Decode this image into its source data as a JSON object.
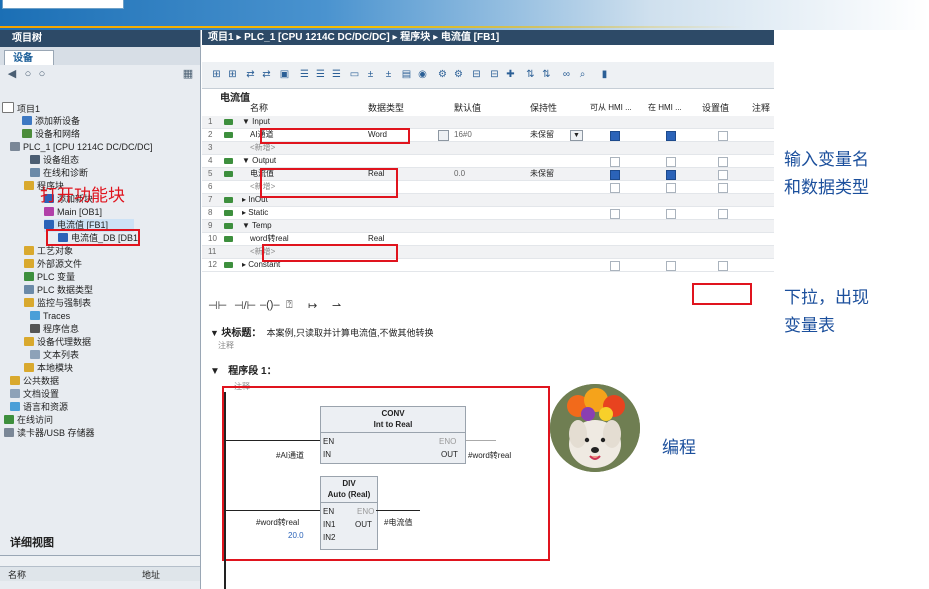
{
  "tree": {
    "title": "项目树",
    "tab": "设备",
    "items": [
      {
        "label": "项目1"
      },
      {
        "label": "添加新设备"
      },
      {
        "label": "设备和网络"
      },
      {
        "label": "PLC_1 [CPU 1214C DC/DC/DC]"
      },
      {
        "label": "设备组态"
      },
      {
        "label": "在线和诊断"
      },
      {
        "label": "程序块"
      },
      {
        "label": "添加新块"
      },
      {
        "label": "Main [OB1]"
      },
      {
        "label": "电流值 [FB1]"
      },
      {
        "label": "电流值_DB [DB1]"
      },
      {
        "label": "工艺对象"
      },
      {
        "label": "外部源文件"
      },
      {
        "label": "PLC 变量"
      },
      {
        "label": "PLC 数据类型"
      },
      {
        "label": "监控与强制表"
      },
      {
        "label": "Traces"
      },
      {
        "label": "程序信息"
      },
      {
        "label": "设备代理数据"
      },
      {
        "label": "文本列表"
      },
      {
        "label": "本地模块"
      },
      {
        "label": "公共数据"
      },
      {
        "label": "文档设置"
      },
      {
        "label": "语言和资源"
      },
      {
        "label": "在线访问"
      },
      {
        "label": "读卡器/USB 存储器"
      }
    ],
    "detail_title": "详细视图",
    "detail_col1": "名称",
    "detail_col2": "地址"
  },
  "editor": {
    "breadcrumb": "项目1 ▸ PLC_1 [CPU 1214C DC/DC/DC] ▸ 程序块 ▸ 电流值 [FB1]",
    "block_name": "电流值",
    "columns": {
      "name": "名称",
      "type": "数据类型",
      "default": "默认值",
      "retain": "保持性",
      "hmi1": "可从 HMI ...",
      "hmi2": "在 HMI ...",
      "setval": "设置值",
      "comment": "注释"
    },
    "rows": [
      {
        "n": "1",
        "name": "▼ Input",
        "type": "",
        "def": "",
        "ret": ""
      },
      {
        "n": "2",
        "name": "AI通道",
        "type": "Word",
        "def": "16#0",
        "ret": "未保留"
      },
      {
        "n": "3",
        "name": "<新增>",
        "type": "",
        "def": "",
        "ret": ""
      },
      {
        "n": "4",
        "name": "▼ Output",
        "type": "",
        "def": "",
        "ret": ""
      },
      {
        "n": "5",
        "name": "电流值",
        "type": "Real",
        "def": "0.0",
        "ret": "未保留"
      },
      {
        "n": "6",
        "name": "<新增>",
        "type": "",
        "def": "",
        "ret": ""
      },
      {
        "n": "7",
        "name": "▸ InOut",
        "type": "",
        "def": "",
        "ret": ""
      },
      {
        "n": "8",
        "name": "▸ Static",
        "type": "",
        "def": "",
        "ret": ""
      },
      {
        "n": "9",
        "name": "▼ Temp",
        "type": "",
        "def": "",
        "ret": ""
      },
      {
        "n": "10",
        "name": "word转real",
        "type": "Real",
        "def": "",
        "ret": ""
      },
      {
        "n": "11",
        "name": "<新增>",
        "type": "",
        "def": "",
        "ret": ""
      },
      {
        "n": "12",
        "name": "▸ Constant",
        "type": "",
        "def": "",
        "ret": ""
      }
    ],
    "block_title_label": "块标题：",
    "block_title_text": "本案例,只读取并计算电流值,不做其他转换",
    "comment_label": "注释",
    "segment_label": "程序段 1：",
    "segment_comment": "注释",
    "conv": {
      "title1": "CONV",
      "title2": "Int to Real",
      "en": "EN",
      "eno": "ENO",
      "in": "IN",
      "out": "OUT",
      "in_arg": "#AI通道",
      "out_arg": "#word转real"
    },
    "div": {
      "title1": "DIV",
      "title2": "Auto (Real)",
      "en": "EN",
      "eno": "ENO",
      "in1": "IN1",
      "in2": "IN2",
      "out": "OUT",
      "in1_arg": "#word转real",
      "in2_arg": "20.0",
      "out_arg": "#电流值"
    }
  },
  "annotations": {
    "open_fb": "打开功能块",
    "input_var": "输入变量名",
    "input_var2": "和数据类型",
    "pulldown": "下拉，出现",
    "pulldown2": "变量表",
    "program": "编程"
  }
}
